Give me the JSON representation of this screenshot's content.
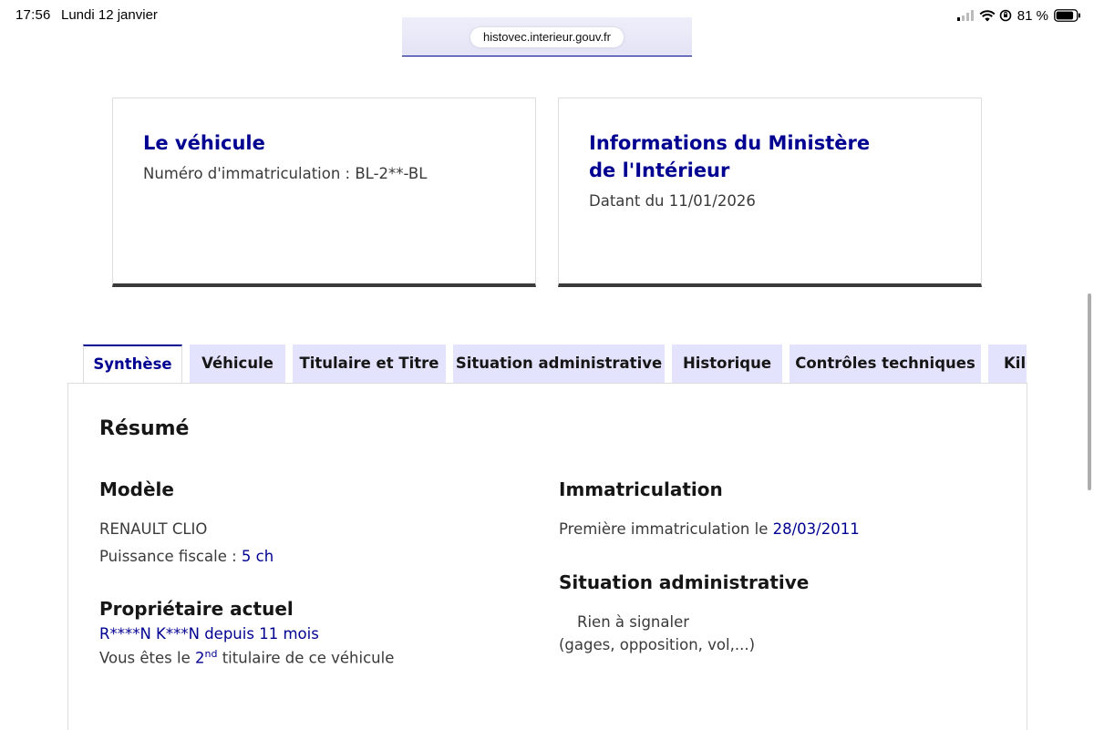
{
  "status_bar": {
    "time": "17:56",
    "date": "Lundi 12 janvier",
    "battery": "81 %"
  },
  "browser": {
    "url": "histovec.interieur.gouv.fr"
  },
  "cards": {
    "vehicle": {
      "title": "Le véhicule",
      "text": "Numéro d'immatriculation : BL-2**-BL"
    },
    "ministry": {
      "title": "Informations du Ministère de l'Intérieur",
      "text": "Datant du 11/01/2026"
    }
  },
  "tabs": [
    {
      "label": "Synthèse",
      "active": true
    },
    {
      "label": "Véhicule",
      "active": false
    },
    {
      "label": "Titulaire et Titre",
      "active": false
    },
    {
      "label": "Situation administrative",
      "active": false
    },
    {
      "label": "Historique",
      "active": false
    },
    {
      "label": "Contrôles techniques",
      "active": false
    },
    {
      "label": "Kilo",
      "active": false
    }
  ],
  "summary": {
    "title": "Résumé",
    "model": {
      "heading": "Modèle",
      "name": "RENAULT CLIO",
      "power_label": "Puissance fiscale : ",
      "power_value": "5 ch"
    },
    "owner": {
      "heading": "Propriétaire actuel",
      "name": "R****N K***N",
      "since_label": " depuis ",
      "since_value": "11 mois",
      "rank_prefix": "Vous êtes le ",
      "rank_num": "2",
      "rank_sup": "nd",
      "rank_suffix": " titulaire de ce véhicule"
    },
    "registration": {
      "heading": "Immatriculation",
      "label": "Première immatriculation le ",
      "date": "28/03/2011"
    },
    "admin": {
      "heading": "Situation administrative",
      "status": "Rien à signaler",
      "detail": "(gages, opposition, vol,...)"
    }
  },
  "colors": {
    "primary_blue": "#000091",
    "tab_background": "#e3e3fd",
    "text_grey": "#3a3a3a"
  }
}
